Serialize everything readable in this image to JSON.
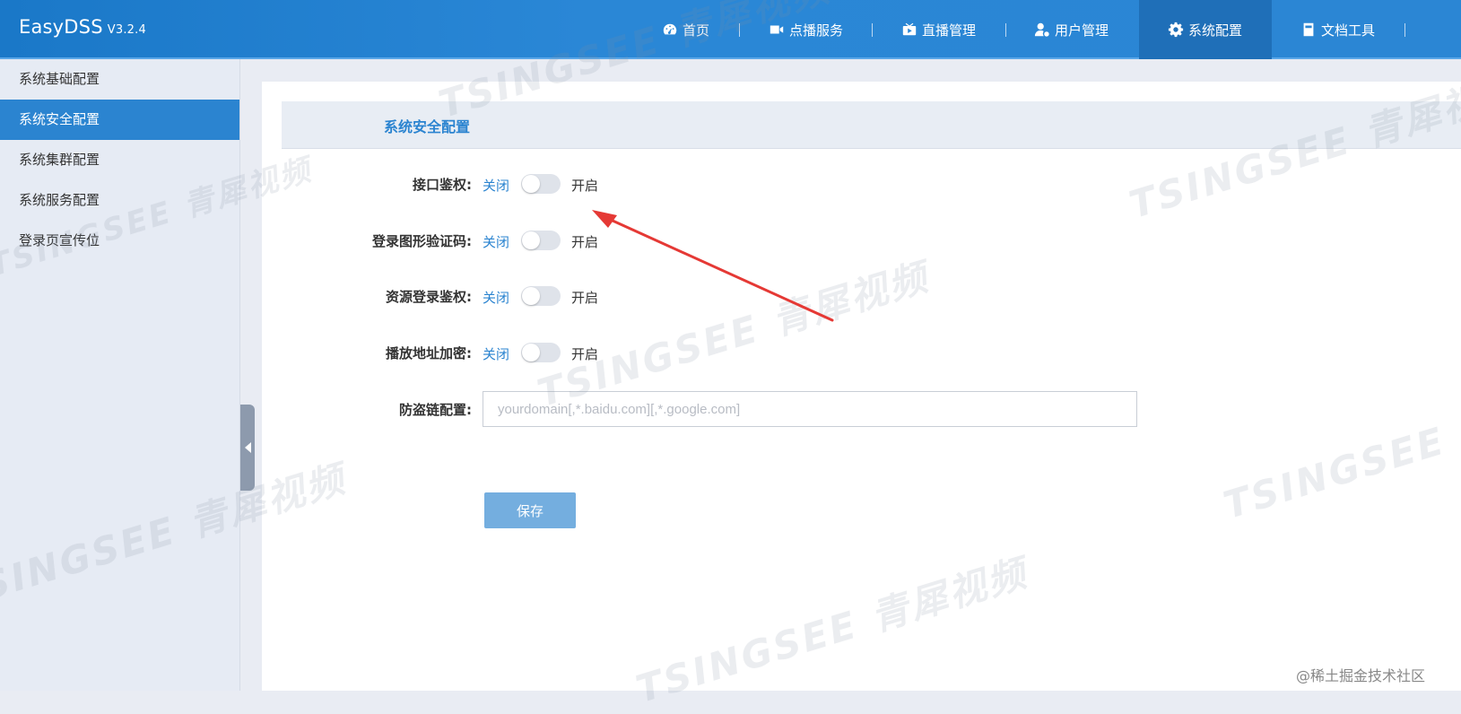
{
  "app": {
    "name": "EasyDSS",
    "version": "V3.2.4"
  },
  "nav": [
    {
      "label": "首页",
      "icon": "dashboard-icon",
      "active": false
    },
    {
      "label": "点播服务",
      "icon": "video-camera-icon",
      "active": false
    },
    {
      "label": "直播管理",
      "icon": "live-tv-icon",
      "active": false
    },
    {
      "label": "用户管理",
      "icon": "user-gear-icon",
      "active": false
    },
    {
      "label": "系统配置",
      "icon": "gear-icon",
      "active": true
    },
    {
      "label": "文档工具",
      "icon": "document-icon",
      "active": false
    }
  ],
  "sidebar": {
    "items": [
      {
        "label": "系统基础配置",
        "active": false
      },
      {
        "label": "系统安全配置",
        "active": true
      },
      {
        "label": "系统集群配置",
        "active": false
      },
      {
        "label": "系统服务配置",
        "active": false
      },
      {
        "label": "登录页宣传位",
        "active": false
      }
    ]
  },
  "main": {
    "section_title": "系统安全配置",
    "switches": [
      {
        "label": "接口鉴权:",
        "off_label": "关闭",
        "on_label": "开启",
        "enabled": false
      },
      {
        "label": "登录图形验证码:",
        "off_label": "关闭",
        "on_label": "开启",
        "enabled": false
      },
      {
        "label": "资源登录鉴权:",
        "off_label": "关闭",
        "on_label": "开启",
        "enabled": false
      },
      {
        "label": "播放地址加密:",
        "off_label": "关闭",
        "on_label": "开启",
        "enabled": false
      }
    ],
    "referer": {
      "label": "防盗链配置:",
      "value": "",
      "placeholder": "yourdomain[,*.baidu.com][,*.google.com]"
    },
    "save_label": "保存"
  },
  "watermark": {
    "text": "TSINGSEE 青犀视频"
  },
  "credit": "@稀土掘金技术社区",
  "colors": {
    "accent": "#2b84d0",
    "annotation_arrow": "#e53935"
  }
}
